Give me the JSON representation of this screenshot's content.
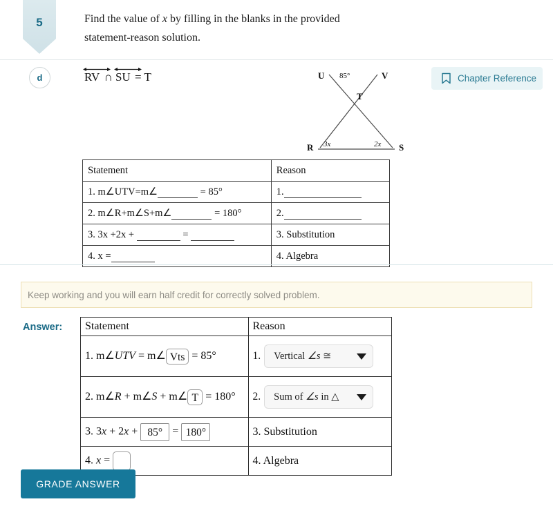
{
  "problem": {
    "number": "5",
    "prompt_line1_pre": "Find the value of ",
    "prompt_var": "x",
    "prompt_line1_post": " by filling in the blanks in the provided",
    "prompt_line2": "statement-reason solution.",
    "part_label": "d",
    "expression": {
      "ray1": "RV",
      "operator": "∩",
      "ray2": "SU",
      "equals": "= T"
    }
  },
  "chapter_reference": {
    "label": "Chapter Reference",
    "icon": "bookmark-icon",
    "accent": "#2b7b93",
    "background": "#e9f4f6"
  },
  "figure": {
    "labels": {
      "U": "U",
      "V": "V",
      "T": "T",
      "R": "R",
      "S": "S",
      "angle_top": "85°",
      "angle_left": "3x",
      "angle_right": "2x"
    }
  },
  "problem_table": {
    "headers": [
      "Statement",
      "Reason"
    ],
    "rows": [
      {
        "statement_pre": "1. m∠UTV=m∠",
        "statement_post": " = 85°",
        "reason": "1."
      },
      {
        "statement_pre": "2. m∠R+m∠S+m∠",
        "statement_post": " = 180°",
        "reason": "2."
      },
      {
        "statement_pre": "3. 3x +2x + ",
        "statement_mid": " = ",
        "statement_post": "",
        "reason": "3. Substitution"
      },
      {
        "statement_pre": "4. x =",
        "statement_post": "",
        "reason": "4. Algebra"
      }
    ]
  },
  "feedback": {
    "message": "Keep working and you will earn half credit for correctly solved problem."
  },
  "answer": {
    "label": "Answer:",
    "headers": [
      "Statement",
      "Reason"
    ],
    "rows": [
      {
        "number": "1.",
        "statement_pre": "1. m∠",
        "statement_italic1": "UTV",
        "statement_mid": " = m∠",
        "input_value": "Vts",
        "statement_post": " = 85°",
        "reason_number": "1.",
        "reason_type": "dropdown",
        "reason_value_pre": "Vertical ",
        "reason_value_italic": "∠s",
        "reason_value_post": " ≅"
      },
      {
        "number": "2.",
        "statement_pre": "2. m∠",
        "statement_italic1": "R",
        "statement_mid2": " + m∠",
        "statement_italic2": "S",
        "statement_mid3": " + m∠",
        "input_value": "T",
        "statement_post": " = 180°",
        "reason_number": "2.",
        "reason_type": "dropdown",
        "reason_value_pre": "Sum of ",
        "reason_value_italic": "∠s",
        "reason_value_post": " in △"
      },
      {
        "number": "3.",
        "statement_pre": "3. 3",
        "statement_italic1": "x",
        "statement_mid2": " + 2",
        "statement_italic2": "x",
        "statement_mid3": " + ",
        "input_value1": "85°",
        "statement_eq": " = ",
        "input_value2": "180°",
        "reason_type": "text",
        "reason": "3. Substitution"
      },
      {
        "number": "4.",
        "statement_pre": "4. ",
        "statement_italic1": "x",
        "statement_mid2": " = ",
        "input_value": "",
        "reason_type": "text",
        "reason": "4. Algebra"
      }
    ]
  },
  "grade_button": {
    "label": "GRADE ANSWER",
    "color": "#16789a"
  }
}
